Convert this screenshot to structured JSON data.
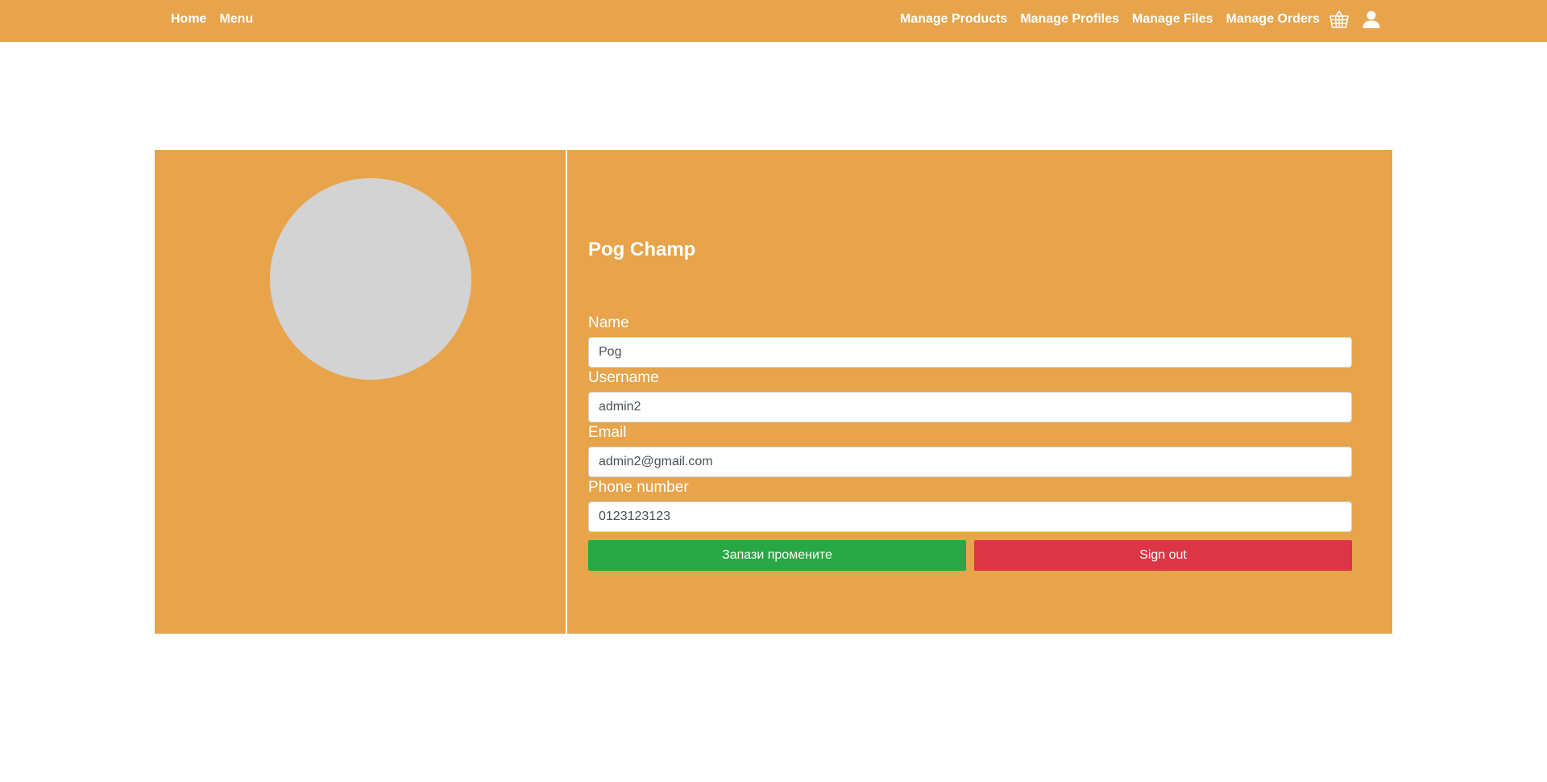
{
  "nav": {
    "left": [
      {
        "label": "Home"
      },
      {
        "label": "Menu"
      }
    ],
    "right": [
      {
        "label": "Manage Products"
      },
      {
        "label": "Manage Profiles"
      },
      {
        "label": "Manage Files"
      },
      {
        "label": "Manage Orders"
      }
    ],
    "icons": [
      "basket-icon",
      "user-icon"
    ]
  },
  "profile": {
    "display_name": "Pog Champ",
    "fields": {
      "name": {
        "label": "Name",
        "value": "Pog"
      },
      "username": {
        "label": "Username",
        "value": "admin2"
      },
      "email": {
        "label": "Email",
        "value": "admin2@gmail.com"
      },
      "phone": {
        "label": "Phone number",
        "value": "0123123123"
      }
    },
    "buttons": {
      "save": "Запази промените",
      "signout": "Sign out"
    }
  },
  "colors": {
    "brand": "#e7a44b",
    "avatar_placeholder": "#d3d3d3",
    "save": "#28a745",
    "signout": "#dc3545"
  }
}
